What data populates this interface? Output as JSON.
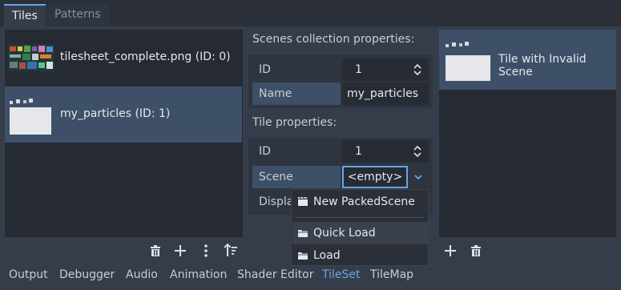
{
  "tabs": [
    {
      "label": "Tiles"
    },
    {
      "label": "Patterns"
    }
  ],
  "sources": [
    {
      "label": "tilesheet_complete.png (ID: 0)"
    },
    {
      "label": "my_particles (ID: 1)"
    }
  ],
  "scenes_collection": {
    "title": "Scenes collection properties:",
    "id_label": "ID",
    "id_value": "1",
    "name_label": "Name",
    "name_value": "my_particles"
  },
  "tile_properties": {
    "title": "Tile properties:",
    "id_label": "ID",
    "id_value": "1",
    "scene_label": "Scene",
    "scene_value": "<empty>",
    "display_label": "Displa"
  },
  "context_menu": {
    "items": [
      {
        "label": "New PackedScene"
      },
      {
        "label": "Quick Load"
      },
      {
        "label": "Load"
      }
    ]
  },
  "tiles": [
    {
      "label": "Tile with Invalid Scene"
    }
  ],
  "bottom_tabs": [
    {
      "label": "Output"
    },
    {
      "label": "Debugger"
    },
    {
      "label": "Audio"
    },
    {
      "label": "Animation"
    },
    {
      "label": "Shader Editor"
    },
    {
      "label": "TileSet"
    },
    {
      "label": "TileMap"
    }
  ],
  "colors": {
    "accent": "#6ba4e6",
    "selected_row": "#3d5068",
    "panel": "#252a33",
    "background": "#363d4a"
  }
}
